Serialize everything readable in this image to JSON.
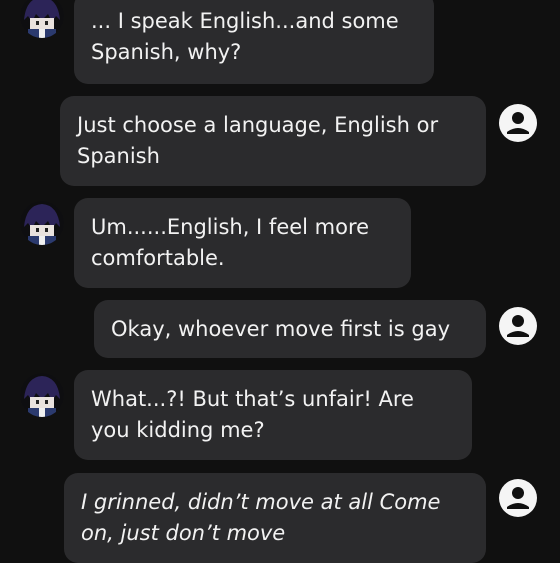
{
  "conversation": {
    "messages": [
      {
        "sender": "bot",
        "text": "... I speak English...and some Spanish, why?"
      },
      {
        "sender": "user",
        "text": "Just choose a language, English or Spanish"
      },
      {
        "sender": "bot",
        "text": "Um......English, I feel more comfortable."
      },
      {
        "sender": "user",
        "text": "Okay, whoever move first is gay"
      },
      {
        "sender": "bot",
        "text": "What...?! But that’s unfair! Are you kidding me?"
      },
      {
        "sender": "user",
        "text": "I grinned, didn’t move at all Come on, just don’t move"
      }
    ]
  },
  "icons": {
    "bot_avatar": "character-avatar",
    "user_avatar": "user-account-icon"
  },
  "colors": {
    "background": "#101010",
    "bubble": "#2b2b2d",
    "text": "#f2f2f2",
    "user_icon": "#f5f5f5",
    "avatar_hair": "#2c2458"
  }
}
